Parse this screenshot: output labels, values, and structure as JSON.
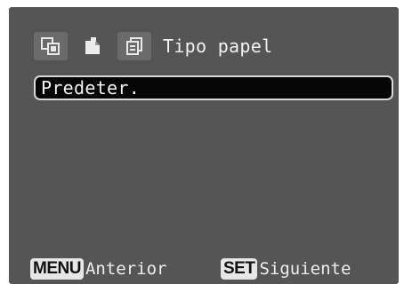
{
  "header": {
    "icons": [
      "print-page-icon",
      "paper-single-icon",
      "paper-type-icon"
    ],
    "title": "Tipo papel"
  },
  "paper_type": {
    "value": "Predeter."
  },
  "footer": {
    "menu_key": "MENU",
    "menu_action": "Anterior",
    "set_key": "SET",
    "set_action": "Siguiente"
  }
}
